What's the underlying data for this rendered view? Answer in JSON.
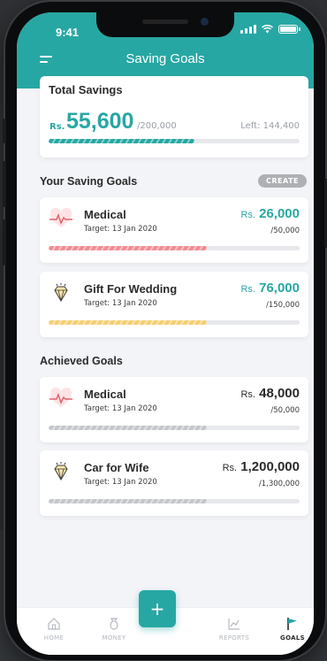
{
  "status": {
    "time": "9:41"
  },
  "header": {
    "title": "Saving Goals",
    "menu_icon": "menu-icon"
  },
  "total": {
    "title": "Total Savings",
    "currency": "Rs.",
    "amount": "55,600",
    "target": "/200,000",
    "left": "Left: 144,400",
    "progress": 0.58
  },
  "your_goals": {
    "title": "Your Saving Goals",
    "create_label": "CREATE",
    "items": [
      {
        "name": "Medical",
        "target": "Target: 13 Jan 2020",
        "currency": "Rs.",
        "amount": "26,000",
        "total": "/50,000",
        "progress": 0.63,
        "color": "#ef8d93",
        "icon": "heartbeat-icon"
      },
      {
        "name": "Gift For Wedding",
        "target": "Target: 13 Jan 2020",
        "currency": "Rs.",
        "amount": "76,000",
        "total": "/150,000",
        "progress": 0.63,
        "color": "#f4cf72",
        "icon": "diamond-icon"
      }
    ]
  },
  "achieved": {
    "title": "Achieved Goals",
    "items": [
      {
        "name": "Medical",
        "target": "Target: 13 Jan 2020",
        "currency": "Rs.",
        "amount": "48,000",
        "total": "/50,000",
        "progress": 0.63,
        "color": "#c4c6ca",
        "icon": "heartbeat-icon"
      },
      {
        "name": "Car for Wife",
        "target": "Target: 13 Jan 2020",
        "currency": "Rs.",
        "amount": "1,200,000",
        "total": "/1,300,000",
        "progress": 0.63,
        "color": "#c4c6ca",
        "icon": "diamond-icon"
      }
    ]
  },
  "tabbar": {
    "items": [
      {
        "label": "HOME",
        "icon": "home-icon",
        "active": false
      },
      {
        "label": "MONEY",
        "icon": "money-icon",
        "active": false
      },
      {
        "label": "REPORTS",
        "icon": "chart-icon",
        "active": false
      },
      {
        "label": "GOALS",
        "icon": "flag-icon",
        "active": true
      }
    ],
    "fab_label": "+"
  },
  "colors": {
    "accent": "#27a7a3",
    "dark_text": "#2b2b2b",
    "muted": "#9aa0a6"
  }
}
